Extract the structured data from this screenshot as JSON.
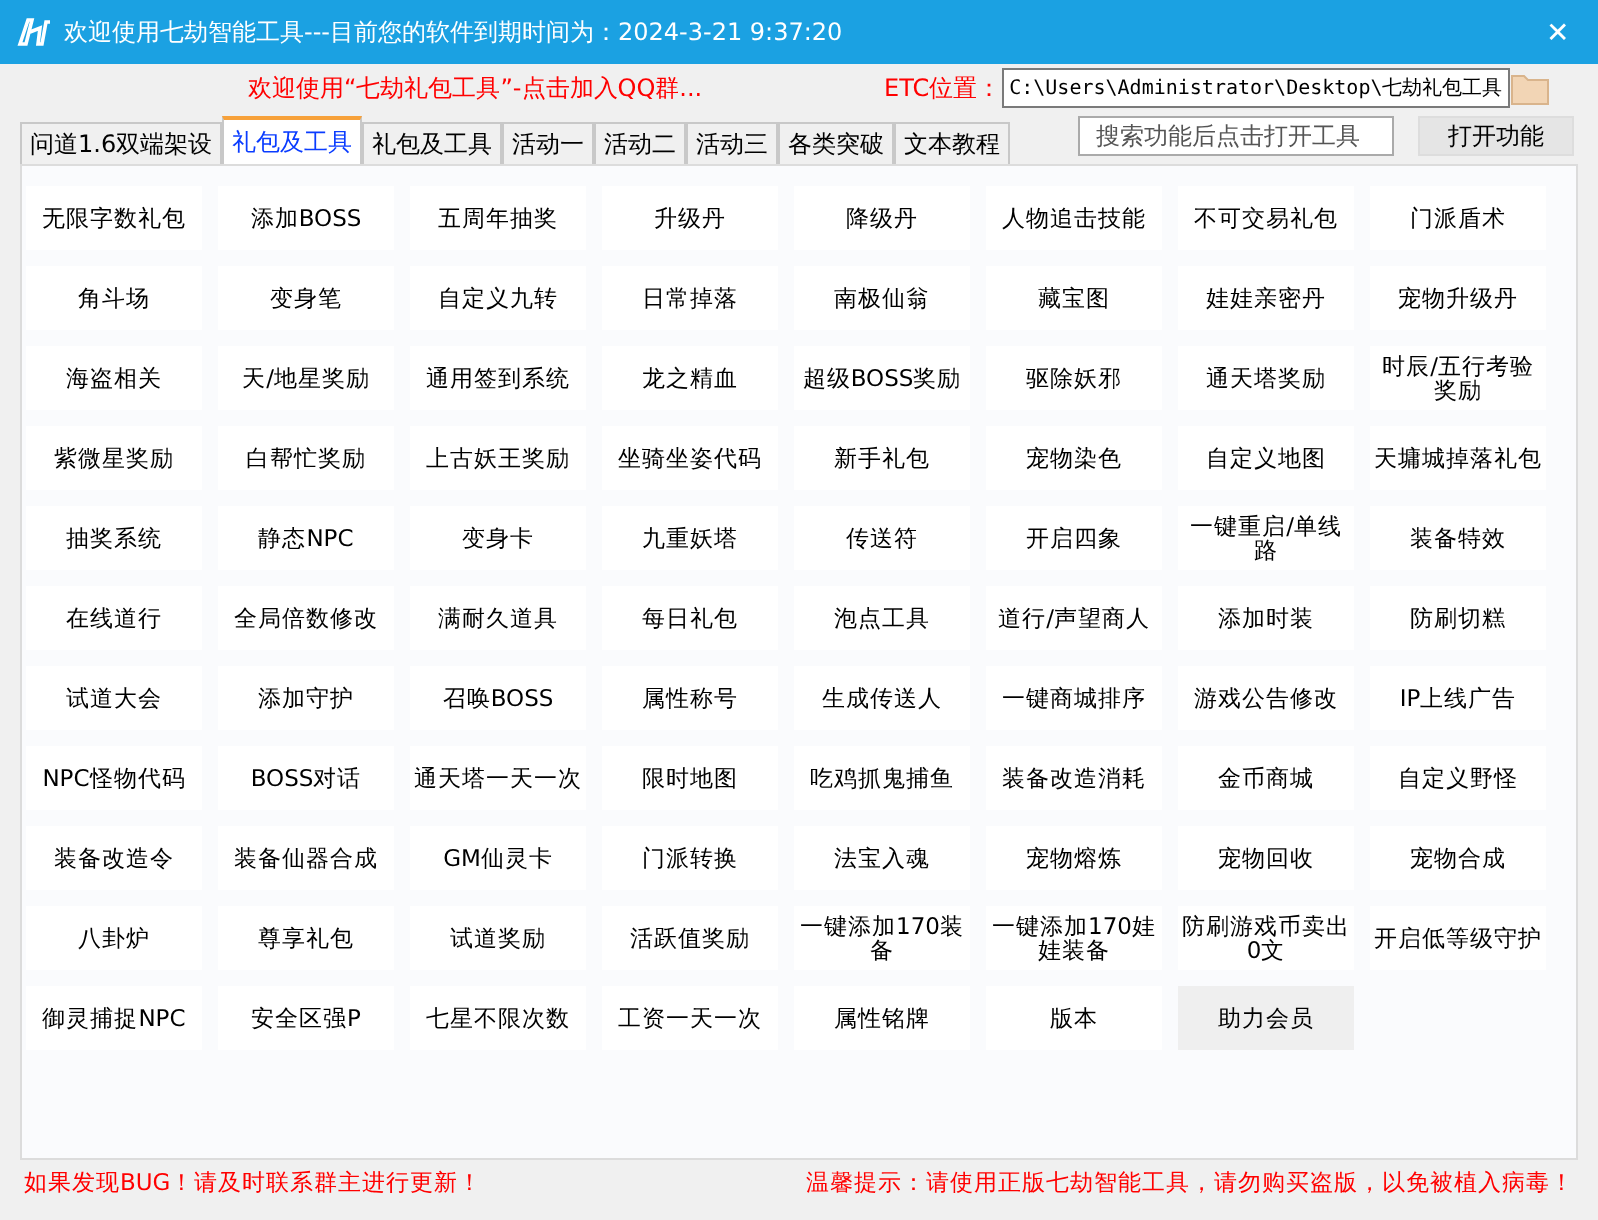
{
  "window": {
    "title": "欢迎使用七劫智能工具---目前您的软件到期时间为：2024-3-21 9:37:20",
    "close": "✕"
  },
  "banner": {
    "link": "欢迎使用“七劫礼包工具”-点击加入QQ群...",
    "path_label": "ETC位置：",
    "path_value": "C:\\Users\\Administrator\\Desktop\\七劫礼包工具"
  },
  "tabs": [
    {
      "label": "问道1.6双端架设",
      "selected": false
    },
    {
      "label": "礼包及工具",
      "selected": true
    },
    {
      "label": "礼包及工具",
      "selected": false
    },
    {
      "label": "活动一",
      "selected": false
    },
    {
      "label": "活动二",
      "selected": false
    },
    {
      "label": "活动三",
      "selected": false
    },
    {
      "label": "各类突破",
      "selected": false
    },
    {
      "label": "文本教程",
      "selected": false
    }
  ],
  "search": {
    "placeholder": "搜索功能后点击打开工具",
    "button": "打开功能"
  },
  "tools": [
    {
      "label": "无限字数礼包",
      "selected": false
    },
    {
      "label": "添加BOSS",
      "selected": false
    },
    {
      "label": "五周年抽奖",
      "selected": false
    },
    {
      "label": "升级丹",
      "selected": false
    },
    {
      "label": "降级丹",
      "selected": false
    },
    {
      "label": "人物追击技能",
      "selected": false
    },
    {
      "label": "不可交易礼包",
      "selected": false
    },
    {
      "label": "门派盾术",
      "selected": false
    },
    {
      "label": "角斗场",
      "selected": false
    },
    {
      "label": "变身笔",
      "selected": false
    },
    {
      "label": "自定义九转",
      "selected": false
    },
    {
      "label": "日常掉落",
      "selected": false
    },
    {
      "label": "南极仙翁",
      "selected": false
    },
    {
      "label": "藏宝图",
      "selected": false
    },
    {
      "label": "娃娃亲密丹",
      "selected": false
    },
    {
      "label": "宠物升级丹",
      "selected": false
    },
    {
      "label": "海盗相关",
      "selected": false
    },
    {
      "label": "天/地星奖励",
      "selected": false
    },
    {
      "label": "通用签到系统",
      "selected": false
    },
    {
      "label": "龙之精血",
      "selected": false
    },
    {
      "label": "超级BOSS奖励",
      "selected": false
    },
    {
      "label": "驱除妖邪",
      "selected": false
    },
    {
      "label": "通天塔奖励",
      "selected": false
    },
    {
      "label": "时辰/五行考验奖励",
      "selected": false
    },
    {
      "label": "紫微星奖励",
      "selected": false
    },
    {
      "label": "白帮忙奖励",
      "selected": false
    },
    {
      "label": "上古妖王奖励",
      "selected": false
    },
    {
      "label": "坐骑坐姿代码",
      "selected": false
    },
    {
      "label": "新手礼包",
      "selected": false
    },
    {
      "label": "宠物染色",
      "selected": false
    },
    {
      "label": "自定义地图",
      "selected": false
    },
    {
      "label": "天墉城掉落礼包",
      "selected": false
    },
    {
      "label": "抽奖系统",
      "selected": false
    },
    {
      "label": "静态NPC",
      "selected": false
    },
    {
      "label": "变身卡",
      "selected": false
    },
    {
      "label": "九重妖塔",
      "selected": false
    },
    {
      "label": "传送符",
      "selected": false
    },
    {
      "label": "开启四象",
      "selected": false
    },
    {
      "label": "一键重启/单线路",
      "selected": false
    },
    {
      "label": "装备特效",
      "selected": false
    },
    {
      "label": "在线道行",
      "selected": false
    },
    {
      "label": "全局倍数修改",
      "selected": false
    },
    {
      "label": "满耐久道具",
      "selected": false
    },
    {
      "label": "每日礼包",
      "selected": false
    },
    {
      "label": "泡点工具",
      "selected": false
    },
    {
      "label": "道行/声望商人",
      "selected": false
    },
    {
      "label": "添加时装",
      "selected": false
    },
    {
      "label": "防刷切糕",
      "selected": false
    },
    {
      "label": "试道大会",
      "selected": false
    },
    {
      "label": "添加守护",
      "selected": false
    },
    {
      "label": "召唤BOSS",
      "selected": false
    },
    {
      "label": "属性称号",
      "selected": false
    },
    {
      "label": "生成传送人",
      "selected": false
    },
    {
      "label": "一键商城排序",
      "selected": false
    },
    {
      "label": "游戏公告修改",
      "selected": false
    },
    {
      "label": "IP上线广告",
      "selected": false
    },
    {
      "label": "NPC怪物代码",
      "selected": false
    },
    {
      "label": "BOSS对话",
      "selected": false
    },
    {
      "label": "通天塔一天一次",
      "selected": false
    },
    {
      "label": "限时地图",
      "selected": false
    },
    {
      "label": "吃鸡抓鬼捕鱼",
      "selected": false
    },
    {
      "label": "装备改造消耗",
      "selected": false
    },
    {
      "label": "金币商城",
      "selected": false
    },
    {
      "label": "自定义野怪",
      "selected": false
    },
    {
      "label": "装备改造令",
      "selected": false
    },
    {
      "label": "装备仙器合成",
      "selected": false
    },
    {
      "label": "GM仙灵卡",
      "selected": false
    },
    {
      "label": "门派转换",
      "selected": false
    },
    {
      "label": "法宝入魂",
      "selected": false
    },
    {
      "label": "宠物熔炼",
      "selected": false
    },
    {
      "label": "宠物回收",
      "selected": false
    },
    {
      "label": "宠物合成",
      "selected": false
    },
    {
      "label": "八卦炉",
      "selected": false
    },
    {
      "label": "尊享礼包",
      "selected": false
    },
    {
      "label": "试道奖励",
      "selected": false
    },
    {
      "label": "活跃值奖励",
      "selected": false
    },
    {
      "label": "一键添加170装备",
      "selected": false
    },
    {
      "label": "一键添加170娃娃装备",
      "selected": false
    },
    {
      "label": "防刷游戏币卖出0文",
      "selected": false
    },
    {
      "label": "开启低等级守护",
      "selected": false
    },
    {
      "label": "御灵捕捉NPC",
      "selected": false
    },
    {
      "label": "安全区强P",
      "selected": false
    },
    {
      "label": "七星不限次数",
      "selected": false
    },
    {
      "label": "工资一天一次",
      "selected": false
    },
    {
      "label": "属性铭牌",
      "selected": false
    },
    {
      "label": "版本",
      "selected": false
    },
    {
      "label": "助力会员",
      "selected": true
    }
  ],
  "footer": {
    "left": "如果发现BUG！请及时联系群主进行更新！",
    "right": "温馨提示：请使用正版七劫智能工具，请勿购买盗版，以免被植入病毒！"
  }
}
